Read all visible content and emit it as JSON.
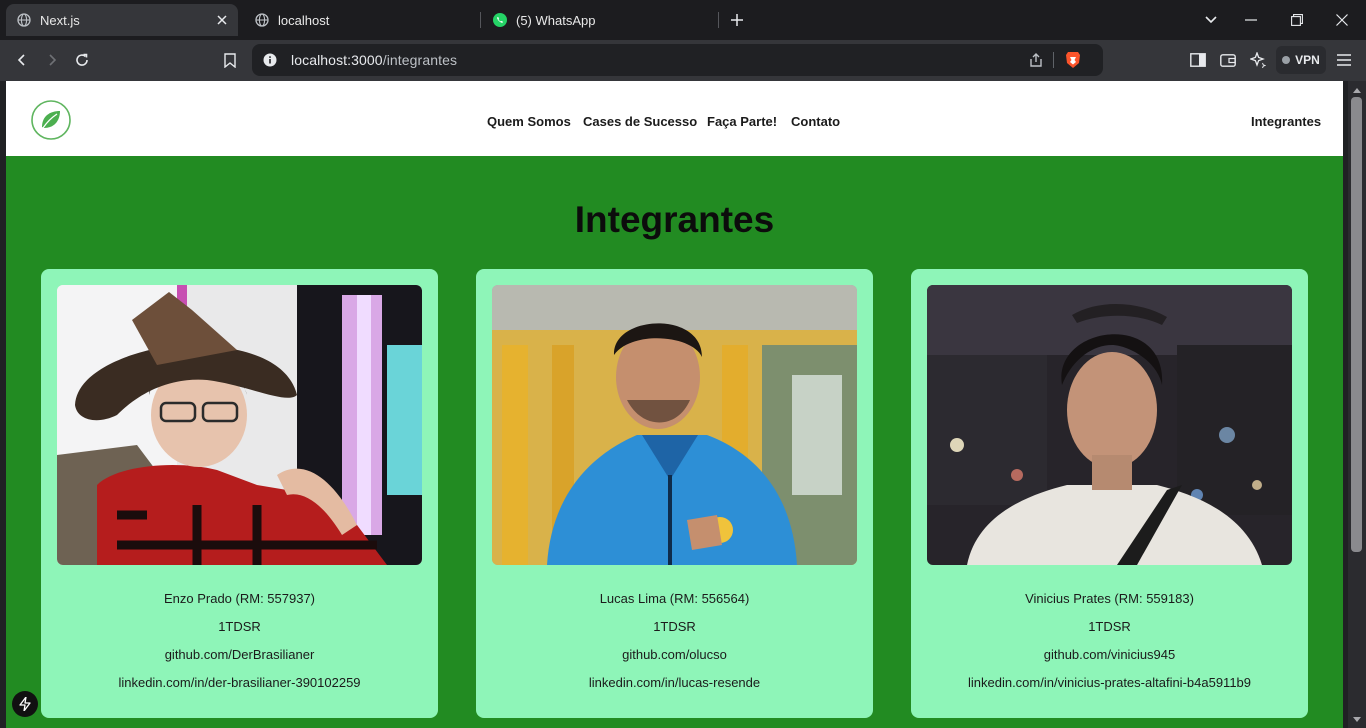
{
  "browser": {
    "tabs": [
      {
        "title": "Next.js",
        "icon": "globe-icon",
        "active": true
      },
      {
        "title": "localhost",
        "icon": "globe-icon",
        "active": false
      },
      {
        "title": "(5) WhatsApp",
        "icon": "whatsapp-icon",
        "active": false
      }
    ],
    "url_host": "localhost:3000",
    "url_path": "/integrantes",
    "vpn_label": "VPN",
    "colors": {
      "tabstrip": "#1c1c1f",
      "toolbar": "#35363a",
      "brave": "#fb542b",
      "whatsapp": "#25d366"
    }
  },
  "site": {
    "nav": {
      "quem_somos": "Quem Somos",
      "cases": "Cases de Sucesso",
      "faca_parte": "Faça Parte!",
      "contato": "Contato",
      "integrantes": "Integrantes"
    },
    "title": "Integrantes",
    "colors": {
      "page_bg": "#228b22",
      "card_bg": "#8ef5b8",
      "header_bg": "#ffffff"
    },
    "members": [
      {
        "name": "Enzo Prado (RM: 557937)",
        "class": "1TDSR",
        "github": "github.com/DerBrasilianer",
        "linkedin": "linkedin.com/in/der-brasilianer-390102259"
      },
      {
        "name": "Lucas Lima (RM: 556564)",
        "class": "1TDSR",
        "github": "github.com/olucso",
        "linkedin": "linkedin.com/in/lucas-resende"
      },
      {
        "name": "Vinicius Prates (RM: 559183)",
        "class": "1TDSR",
        "github": "github.com/vinicius945",
        "linkedin": "linkedin.com/in/vinicius-prates-altafini-b4a5911b9"
      }
    ]
  }
}
